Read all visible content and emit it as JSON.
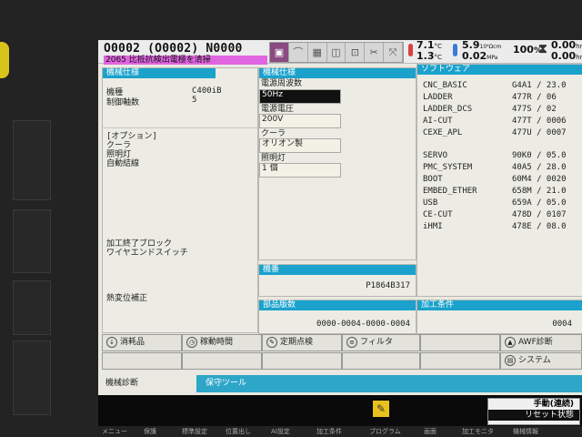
{
  "header": {
    "program": "O0002  (O0002)  N0000",
    "alarm": "2065 比抵抗検出電極を清掃",
    "icons": [
      "tool-icon",
      "shape-icon",
      "grid-icon",
      "graph-icon",
      "wire-icon",
      "scissors-icon",
      "xy-icon",
      "highlight-icon"
    ],
    "temp1": "7.1",
    "temp1_unit": "°C",
    "temp2": "1.3",
    "temp2_unit": "°C",
    "resist": "5.9",
    "resist_unit": "10⁴Ωcm",
    "pressure": "0.02",
    "pressure_unit": "MPa",
    "tank": "100",
    "tank_unit": "%",
    "timer": "0.00",
    "timer_unit": "hr"
  },
  "machine_spec": {
    "title": "機械仕様",
    "model_label": "機種",
    "model_value": "C400iB",
    "axes_label": "制御軸数",
    "axes_value": "5",
    "options_label": "[オプション]",
    "options": [
      "クーラ",
      "照明灯",
      "自動結線"
    ],
    "more_options": [
      "加工終了ブロック",
      "ワイヤエンドスイッチ"
    ],
    "thermal": "熱変位補正"
  },
  "machine_spec2": {
    "title": "機械仕様",
    "freq_label": "電源周波数",
    "freq_value": "50Hz",
    "voltage_label": "電源電圧",
    "voltage_value": "200V",
    "cooler_label": "クーラ",
    "cooler_value": "オリオン製",
    "light_label": "照明灯",
    "light_value": "1 個"
  },
  "serial": {
    "title": "機番",
    "value": "P1864B317"
  },
  "parts": {
    "title": "部品版数",
    "value": "0000-0004-0000-0004"
  },
  "software": {
    "title": "ソフトウェア",
    "rows": [
      {
        "name": "CNC_BASIC",
        "ver": "G4A1 / 23.0"
      },
      {
        "name": "LADDER",
        "ver": "477R /  06"
      },
      {
        "name": "LADDER_DCS",
        "ver": "477S /  02"
      },
      {
        "name": "AI-CUT",
        "ver": "477T / 0006"
      },
      {
        "name": "CEXE_APL",
        "ver": "477U / 0007"
      },
      {
        "name": "SERVO",
        "ver": "90K0 / 05.0"
      },
      {
        "name": "PMC_SYSTEM",
        "ver": "40A5 / 28.0"
      },
      {
        "name": "BOOT",
        "ver": "60M4 / 0020"
      },
      {
        "name": "EMBED_ETHER",
        "ver": "658M / 21.0"
      },
      {
        "name": "USB",
        "ver": "659A / 05.0"
      },
      {
        "name": "CE-CUT",
        "ver": "478D / 0107"
      },
      {
        "name": "iHMI",
        "ver": "478E / 08.0"
      }
    ]
  },
  "machining": {
    "title": "加工条件",
    "value": "0004"
  },
  "softkeys": [
    "消耗品",
    "稼動時間",
    "定期点検",
    "フィルタ",
    "AWF診断",
    "システム"
  ],
  "tabs": [
    "機械診断",
    "保守ツール"
  ],
  "mode": {
    "line1": "手動(連続)",
    "line2": "リセット状態"
  },
  "menu": [
    "メニュー",
    "保護",
    "標準設定",
    "位置出し",
    "AI設定",
    "加工条件",
    "プログラム",
    "画面",
    "加工モニタ",
    "機械情報"
  ]
}
